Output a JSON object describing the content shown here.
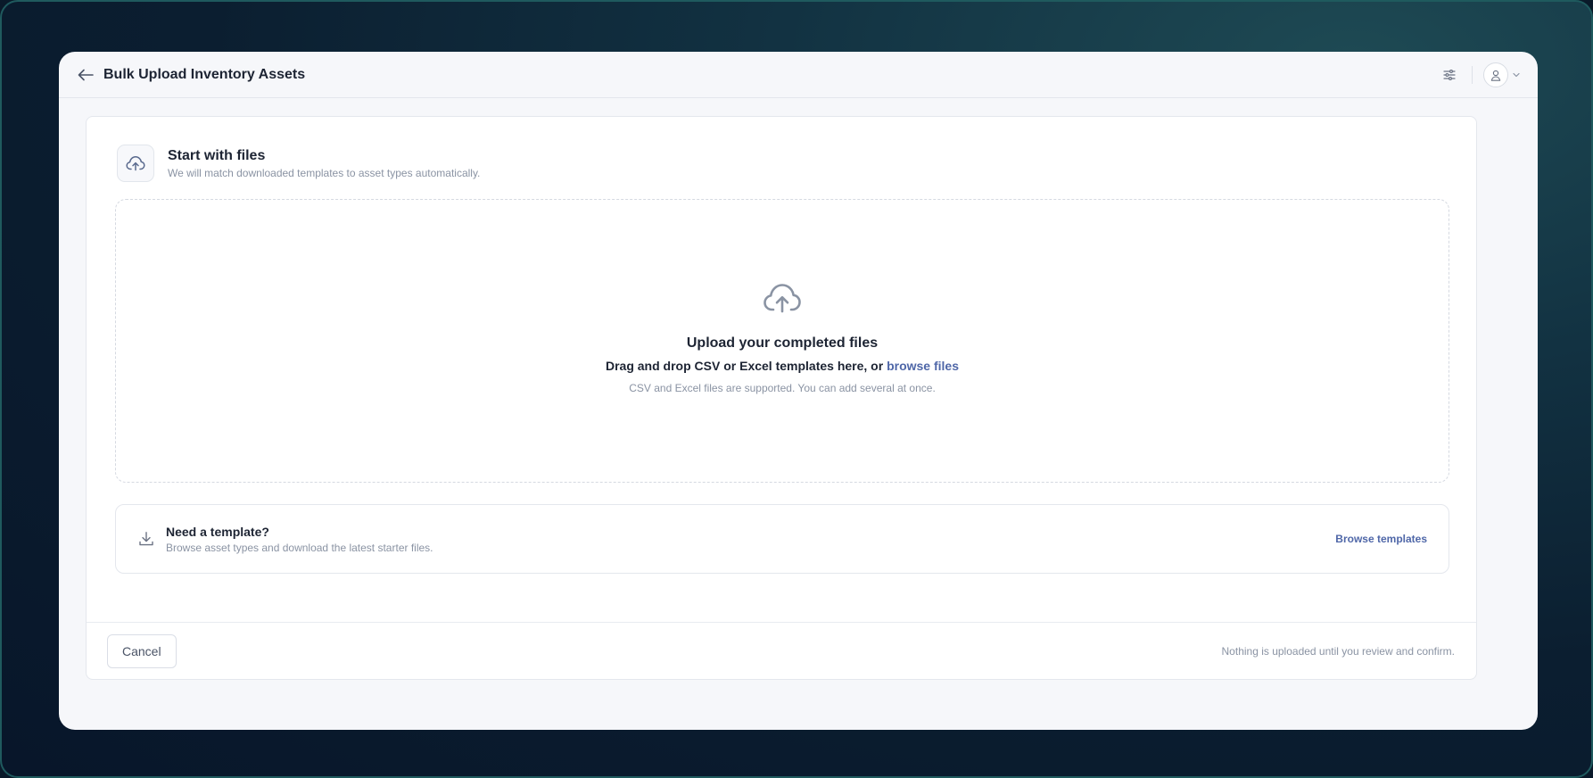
{
  "window": {
    "title": "Bulk Upload Inventory Assets"
  },
  "icons": {
    "back": "arrow-left-icon",
    "settings": "sliders-icon",
    "avatar": "user-icon",
    "menu": "chevron-down-icon",
    "section": "cloud-upload-icon",
    "dropzone": "cloud-upload-icon",
    "template": "download-icon"
  },
  "section": {
    "title": "Start with files",
    "subtitle": "We will match downloaded templates to asset types automatically."
  },
  "dropzone": {
    "title": "Upload your completed files",
    "instruction_prefix": "Drag and drop CSV or Excel templates here, or ",
    "browse_link": "browse files",
    "note": "CSV and Excel files are supported. You can add several at once."
  },
  "template": {
    "title": "Need a template?",
    "subtitle": "Browse asset types and download the latest starter files.",
    "link": "Browse templates"
  },
  "footer": {
    "cancel_label": "Cancel",
    "note": "Nothing is uploaded until you review and confirm."
  },
  "colors": {
    "accent": "#4f67a8",
    "text": "#1d2433",
    "muted": "#8a93a3",
    "window_bg": "#f6f7fa",
    "backdrop": "#0b1e30"
  }
}
